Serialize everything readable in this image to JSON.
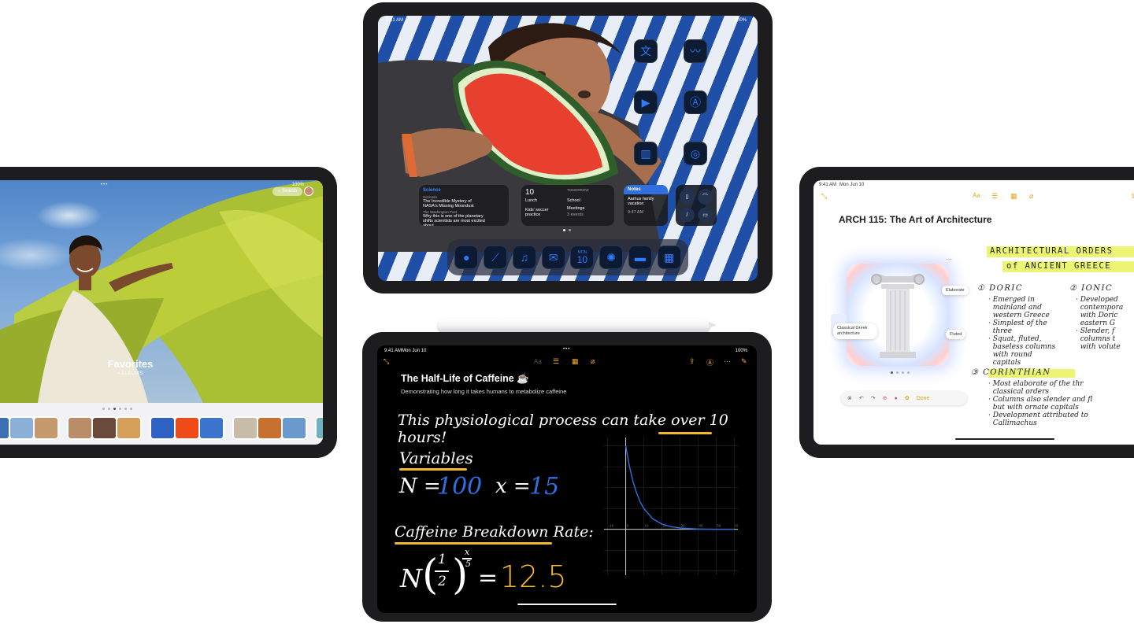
{
  "left_ipad": {
    "status_right": "100%",
    "search_label": "Search",
    "album_title": "Favorites",
    "album_subtitle": "ALBUMS"
  },
  "top_ipad": {
    "status_left": "9:41 AM",
    "status_right": "100%",
    "widget_news": {
      "category": "Science",
      "source1": "Gizmodo",
      "headline1": "The Incredible Mystery of NASA's Missing Moondust",
      "source2": "The Washington Post",
      "headline2": "Why this is one of the planetary shifts scientists are most excited about"
    },
    "widget_calendar": {
      "day": "10",
      "tomorrow_label": "TOMORROW",
      "event1": "Lunch",
      "event2": "Kids' soccer practice",
      "event3": "School",
      "event4": "Meetings",
      "more": "3 events"
    },
    "widget_notes": {
      "title": "Notes",
      "text": "Aarhus family vacation",
      "time": "9:47 AM"
    },
    "dock_calendar_day": "MON",
    "dock_calendar_date": "10"
  },
  "bottom_ipad": {
    "status_left": "9:41 AM",
    "status_date": "Mon Jun 10",
    "status_right": "100%",
    "title": "The Half-Life of Caffeine ☕",
    "subtitle": "Demonstrating how long it takes humans to metabolize caffeine",
    "line1_prefix": "This physiological process can take over ",
    "line1_highlight": "10 hours",
    "line1_suffix": "!",
    "variables_heading": "Variables",
    "var_n_label": "N =",
    "var_n_value": "100",
    "var_x_label": "x =",
    "var_x_value": "15",
    "rate_heading": "Caffeine Breakdown Rate:",
    "formula_n": "N",
    "formula_num": "1",
    "formula_den": "2",
    "formula_exp_num": "x",
    "formula_exp_den": "5",
    "formula_equals": "=",
    "formula_result": "12.5",
    "font_button": "Aa"
  },
  "right_ipad": {
    "status_left": "9:41 AM",
    "status_date": "Mon Jun 10",
    "font_button": "Aa",
    "title": "ARCH 115: The Art of Architecture",
    "heading1": "ARCHITECTURAL ORDERS",
    "heading2": "of ANCIENT GREECE",
    "doric_title": "① DORIC",
    "doric_notes": "· Emerged in\n  mainland and\n  western Greece\n· Simplest of the\n  three\n· Squat, fluted,\n  baseless columns\n  with round\n  capitals",
    "ionic_title": "② IONIC",
    "ionic_notes": "· Developed\n  contempora\n  with Doric\n  eastern G\n· Slender, f\n  columns t\n  with volute",
    "corinthian_title": "③ CORINTHIAN",
    "corinthian_notes": "· Most elaborate of the thr\n  classical orders\n· Columns also slender and fl\n  but with ornate capitals\n· Development attributed to\n  Callimachus",
    "pill_elaborate": "Elaborate",
    "pill_fluted": "Fluted",
    "pill_classical": "Classical Greek architecture",
    "done_label": "Done"
  },
  "chart_data": {
    "type": "line",
    "title": "",
    "x_ticks": [
      "-10",
      "0",
      "10",
      "20",
      "30",
      "40",
      "50",
      "60"
    ],
    "x": [
      0,
      2,
      4,
      6,
      8,
      10,
      15,
      20,
      25,
      30,
      40,
      50,
      60
    ],
    "y": [
      100,
      75.8,
      57.4,
      43.5,
      33.0,
      25.0,
      12.5,
      6.25,
      3.13,
      1.56,
      0.39,
      0.1,
      0.02
    ],
    "formula": "N(1/2)^(x/5), N = 100",
    "xlim": [
      -12,
      62
    ],
    "ylim": [
      -55,
      110
    ],
    "grid": true,
    "line_color": "#2f6fe0"
  },
  "colors": {
    "notes_accent": "#f7b12b",
    "pencil_blue": "#2f6fe0",
    "highlighter": "#e9f25c"
  }
}
